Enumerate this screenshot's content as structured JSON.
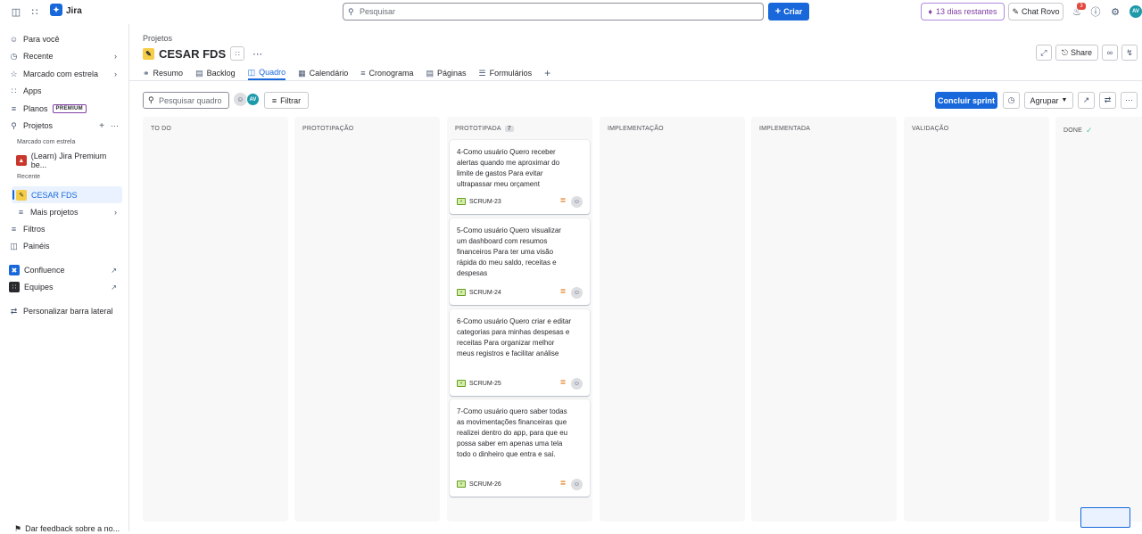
{
  "topbar": {
    "app_name": "Jira",
    "search_placeholder": "Pesquisar",
    "create_label": "Criar",
    "trial_label": "13 dias restantes",
    "rovo_label": "Chat Rovo",
    "notification_count": "3",
    "avatar_initials": "AV"
  },
  "sidebar": {
    "items": [
      {
        "label": "Para você",
        "icon": "person-circle-icon"
      },
      {
        "label": "Recente",
        "icon": "clock-icon"
      },
      {
        "label": "Marcado com estrela",
        "icon": "star-icon"
      },
      {
        "label": "Apps",
        "icon": "apps-icon"
      },
      {
        "label": "Planos",
        "icon": "plans-icon",
        "badge": "PREMIUM"
      },
      {
        "label": "Projetos",
        "icon": "projects-icon"
      }
    ],
    "starred_section": "Marcado com estrela",
    "starred_project": "(Learn) Jira Premium be...",
    "recent_section": "Recente",
    "recent_project": "CESAR FDS",
    "more_projects": "Mais projetos",
    "filters": "Filtros",
    "dashboards": "Painéis",
    "confluence": "Confluence",
    "teams": "Equipes",
    "customize": "Personalizar barra lateral",
    "feedback": "Dar feedback sobre a no..."
  },
  "header": {
    "breadcrumb": "Projetos",
    "title": "CESAR FDS",
    "share_label": "Share",
    "tabs": [
      {
        "label": "Resumo",
        "icon": "globe-icon"
      },
      {
        "label": "Backlog",
        "icon": "backlog-icon"
      },
      {
        "label": "Quadro",
        "icon": "board-icon"
      },
      {
        "label": "Calendário",
        "icon": "calendar-icon"
      },
      {
        "label": "Cronograma",
        "icon": "timeline-icon"
      },
      {
        "label": "Páginas",
        "icon": "pages-icon"
      },
      {
        "label": "Formulários",
        "icon": "forms-icon"
      }
    ],
    "active_tab": "Quadro"
  },
  "board": {
    "search_placeholder": "Pesquisar quadro",
    "avatar_initials": "AV",
    "filter_label": "Filtrar",
    "complete_sprint_label": "Concluir sprint",
    "group_label": "Agrupar",
    "columns": [
      {
        "name": "TO DO"
      },
      {
        "name": "PROTOTIPAÇÃO"
      },
      {
        "name": "PROTOTIPADA",
        "count": "7"
      },
      {
        "name": "IMPLEMENTAÇÃO"
      },
      {
        "name": "IMPLEMENTADA"
      },
      {
        "name": "VALIDAÇÃO"
      },
      {
        "name": "DONE"
      }
    ],
    "cards": [
      {
        "text": "4-Como usuário Quero receber alertas quando me aproximar do limite de gastos Para evitar ultrapassar meu orçament",
        "key": "SCRUM-23"
      },
      {
        "text": "5-Como usuário Quero visualizar um dashboard com resumos financeiros Para ter uma visão rápida do meu saldo, receitas e despesas",
        "key": "SCRUM-24"
      },
      {
        "text": "6-Como usuário Quero criar e editar categorias para minhas despesas e receitas Para organizar melhor meus registros e facilitar análise",
        "key": "SCRUM-25"
      },
      {
        "text": "7-Como usuário quero saber todas as movimentações financeiras que realizei dentro do app, para que eu possa saber em apenas uma tela todo o dinheiro que entra e saí.",
        "key": "SCRUM-26"
      }
    ]
  },
  "colors": {
    "brand": "#1868DB",
    "priority_medium": "#E06C00",
    "story": "#6A9A23",
    "done": "#4BCE97"
  }
}
